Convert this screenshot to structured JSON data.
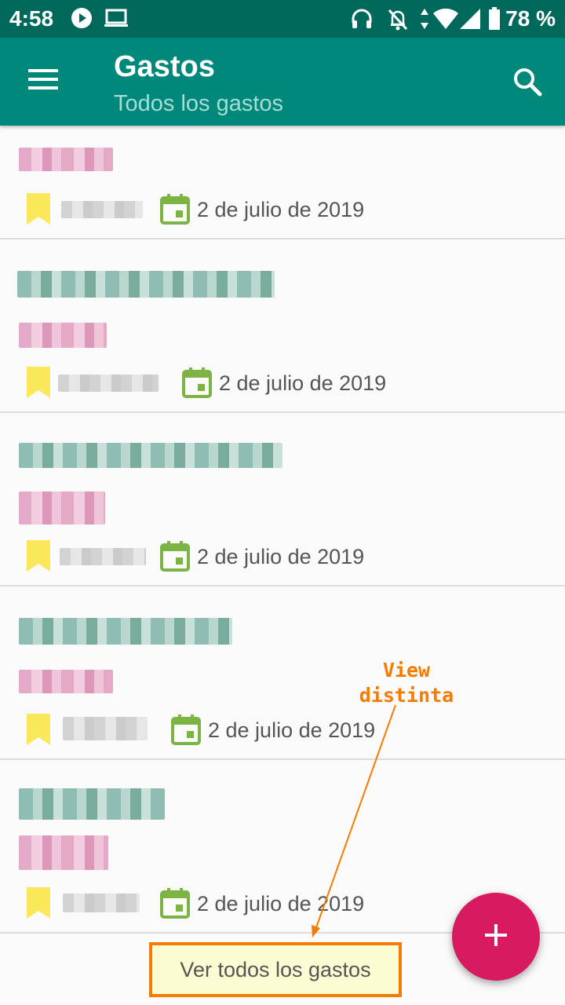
{
  "status_bar": {
    "time": "4:58",
    "battery": "78 %",
    "icons": [
      "play-icon",
      "laptop-icon",
      "headphones-icon",
      "notifications-off-icon",
      "data-arrows-icon",
      "wifi-icon",
      "signal-icon",
      "battery-icon"
    ]
  },
  "app_bar": {
    "title": "Gastos",
    "subtitle": "Todos los gastos",
    "menu_icon": "menu-icon",
    "search_icon": "search-icon"
  },
  "expenses": [
    {
      "date": "2 de julio de 2019",
      "bookmark_color": "#fbe85a"
    },
    {
      "date": "2 de julio de 2019",
      "bookmark_color": "#fbe85a"
    },
    {
      "date": "2 de julio de 2019",
      "bookmark_color": "#fbe85a"
    },
    {
      "date": "2 de julio de 2019",
      "bookmark_color": "#fbe85a"
    },
    {
      "date": "2 de julio de 2019",
      "bookmark_color": "#fbe85a"
    }
  ],
  "footer": {
    "label": "Ver todos los gastos"
  },
  "annotation": {
    "line1": "View",
    "line2": "distinta"
  },
  "colors": {
    "status_bar": "#00695c",
    "app_bar": "#00897b",
    "fab": "#d81b60",
    "calendar_icon": "#7cb342",
    "annotation": "#f57c00"
  }
}
